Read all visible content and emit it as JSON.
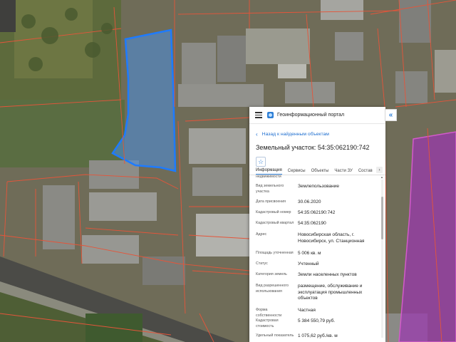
{
  "header": {
    "title": "Геоинформационный портал",
    "collapse_glyph": "«"
  },
  "icons": {
    "menu": "hamburger-icon",
    "logo": "portal-logo-icon",
    "favorite": "star-icon",
    "back": "chevron-left-icon"
  },
  "nav": {
    "back_label": "Назад к найденным объектам"
  },
  "parcel": {
    "title": "Земельный участок: 54:35:062190:742"
  },
  "tabs": [
    {
      "label": "Информация",
      "active": true
    },
    {
      "label": "Сервисы",
      "active": false
    },
    {
      "label": "Объекты",
      "active": false
    },
    {
      "label": "Части ЗУ",
      "active": false
    },
    {
      "label": "Состав",
      "active": false
    }
  ],
  "tabs_more": "›",
  "properties": [
    {
      "key": "недвижимости",
      "value": ""
    },
    {
      "key": "Вид земельного участка",
      "value": "Землепользование"
    },
    {
      "key": "Дата присвоения",
      "value": "30.06.2020"
    },
    {
      "key": "Кадастровый номер",
      "value": "54:35:062190:742"
    },
    {
      "key": "Кадастровый квартал",
      "value": "54:35:062190"
    },
    {
      "key": "Адрес",
      "value": "Новосибирская область, г. Новосибирск, ул. Станционная"
    },
    {
      "key": "Площадь уточненная",
      "value": "5 006 кв. м"
    },
    {
      "key": "Статус",
      "value": "Учтенный"
    },
    {
      "key": "Категория земель",
      "value": "Земли населенных пунктов"
    },
    {
      "key": "Вид разрешенного использования",
      "value": "размещение, обслуживание и эксплуатация промышленных объектов"
    },
    {
      "key": "Форма собственности",
      "value": "Частная"
    },
    {
      "key": "Кадастровая стоимость",
      "value": "5 384 550,79 руб."
    },
    {
      "key": "Удельный показатель",
      "value": "1 075,62 руб./кв. м"
    }
  ],
  "colors": {
    "accent": "#2f7fd6",
    "selected_parcel_fill": "#4a90e2",
    "parcel_border": "#e5553a",
    "highlight_parcel": "#b03cc4"
  }
}
